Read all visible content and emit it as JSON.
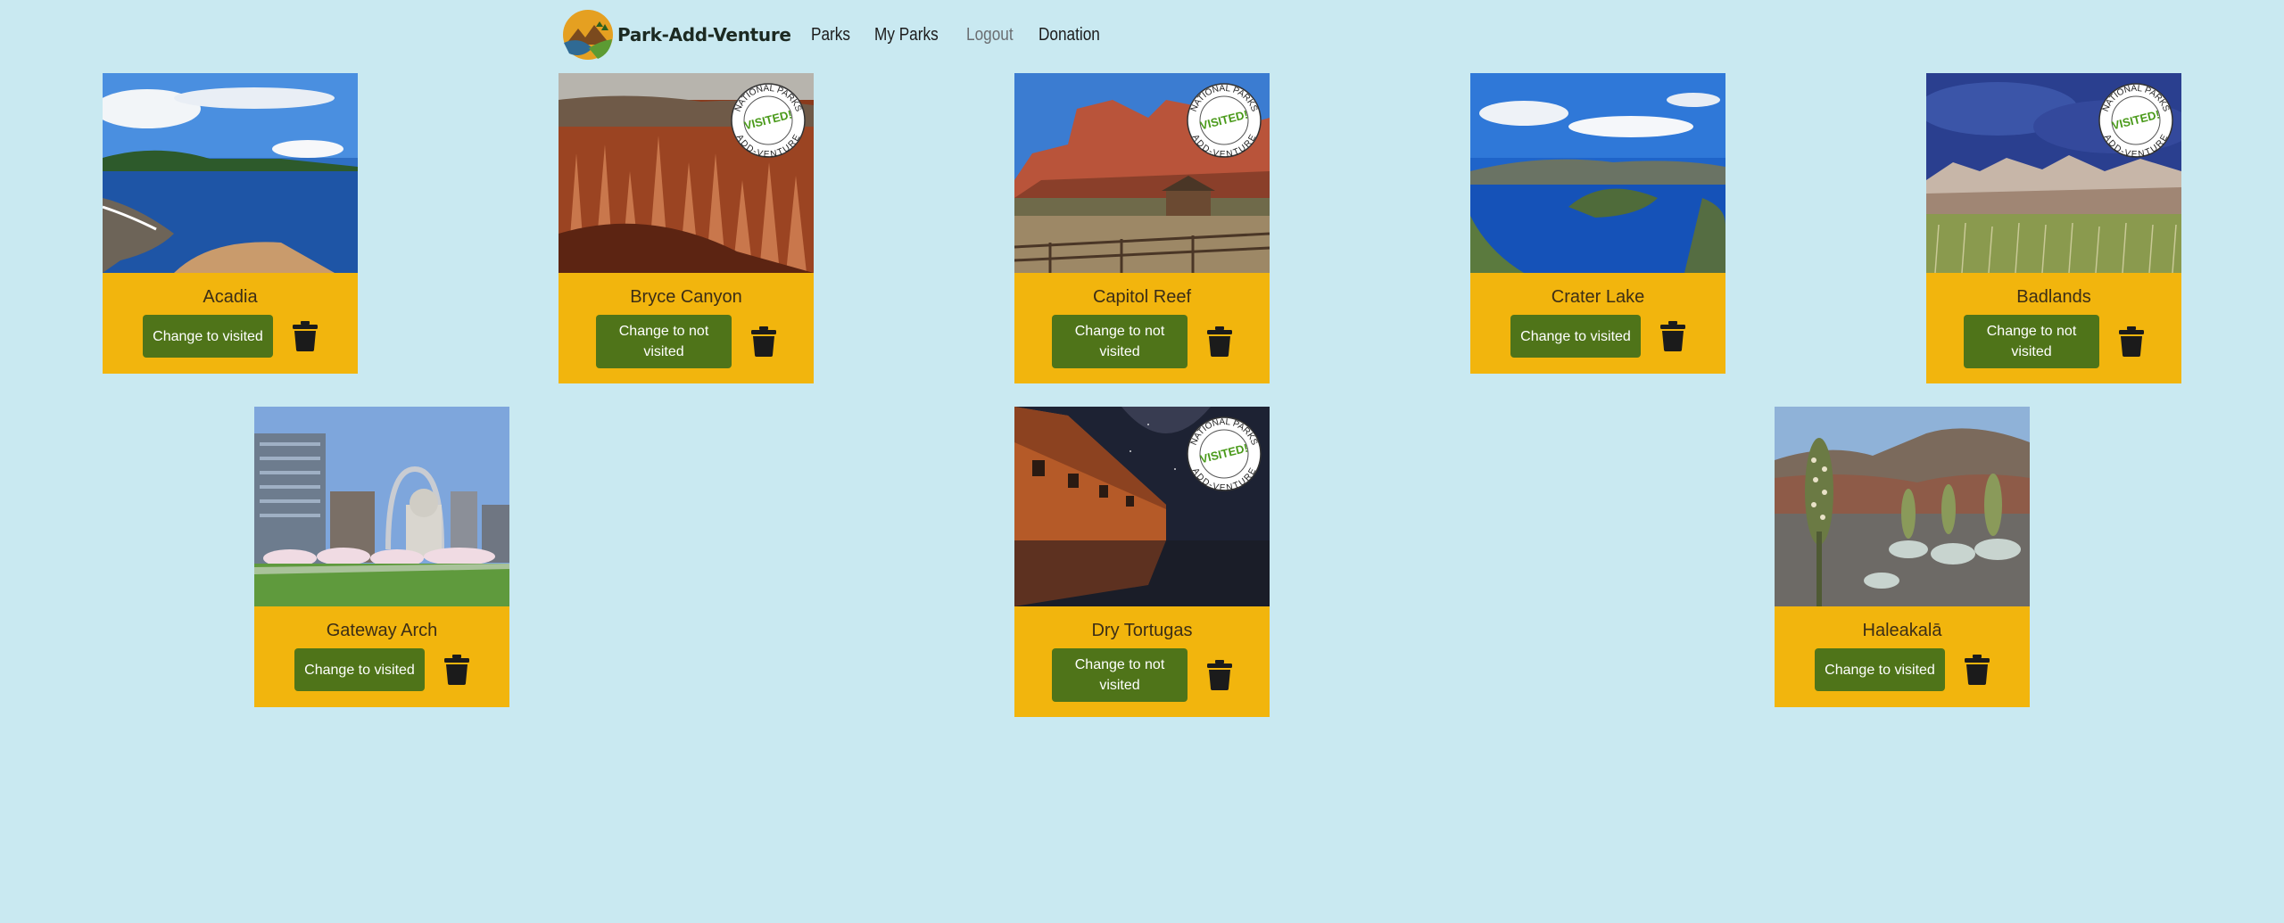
{
  "nav": {
    "brand": "Park-Add-Venture",
    "links": [
      "Parks",
      "My Parks",
      "Logout",
      "Donation"
    ]
  },
  "stamp": {
    "top": "NATIONAL PARKS",
    "middle": "VISITED!",
    "bottom": "ADD-VENTURE"
  },
  "parks": [
    {
      "name": "Acadia",
      "button": "Change to visited",
      "visited": false
    },
    {
      "name": "Bryce Canyon",
      "button": "Change to not visited",
      "visited": true
    },
    {
      "name": "Capitol Reef",
      "button": "Change to not visited",
      "visited": true
    },
    {
      "name": "Crater Lake",
      "button": "Change to visited",
      "visited": false
    },
    {
      "name": "Badlands",
      "button": "Change to not visited",
      "visited": true
    },
    {
      "name": "Gateway Arch",
      "button": "Change to visited",
      "visited": false
    },
    {
      "name": "Dry Tortugas",
      "button": "Change to not visited",
      "visited": true
    },
    {
      "name": "Haleakalā",
      "button": "Change to visited",
      "visited": false
    }
  ],
  "colors": {
    "background": "#c9e9f1",
    "card": "#f2b50d",
    "button": "#4f7419",
    "stamp_green": "#4a9a1a"
  },
  "icons": [
    "park-logo-icon",
    "trash-icon",
    "visited-stamp-icon"
  ]
}
